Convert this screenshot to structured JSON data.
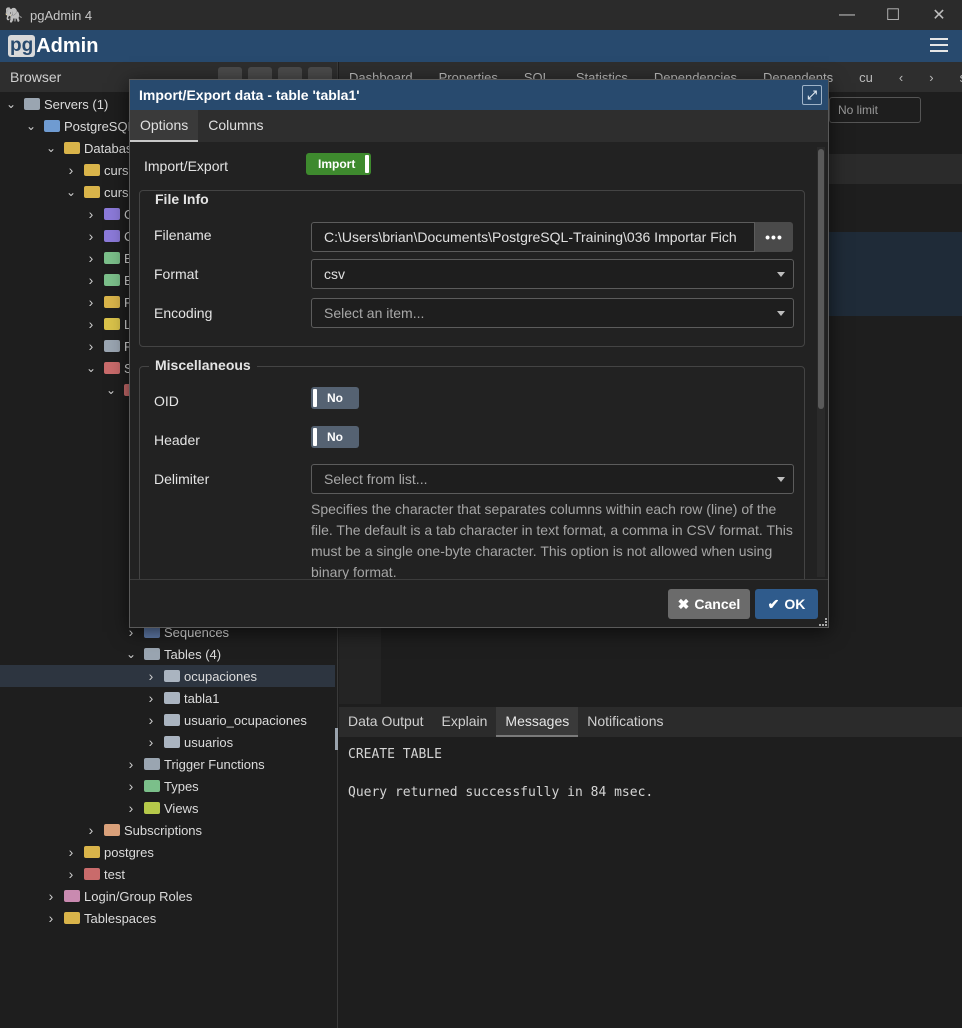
{
  "window": {
    "title": "pgAdmin 4",
    "minimize_icon": "minimize-icon",
    "maximize_icon": "maximize-icon",
    "close_icon": "close-icon"
  },
  "app": {
    "logo_pg": "pg",
    "logo_admin": "Admin",
    "brand_color": "#284a6e"
  },
  "browser": {
    "title": "Browser",
    "tree": [
      {
        "label": "Servers (1)",
        "level": 0,
        "open": true,
        "icon": "servers-icon"
      },
      {
        "label": "PostgreSQL",
        "level": 1,
        "open": true,
        "icon": "elephant-icon"
      },
      {
        "label": "Databas",
        "level": 2,
        "open": true,
        "icon": "databases-icon"
      },
      {
        "label": "curso",
        "level": 3,
        "open": false,
        "icon": "database-icon"
      },
      {
        "label": "curso",
        "level": 3,
        "open": true,
        "icon": "database-icon"
      },
      {
        "label": "C",
        "level": 4,
        "open": false,
        "icon": "casts-icon"
      },
      {
        "label": "C",
        "level": 4,
        "open": false,
        "icon": "catalogs-icon"
      },
      {
        "label": "E",
        "level": 4,
        "open": false,
        "icon": "event-triggers-icon"
      },
      {
        "label": "E",
        "level": 4,
        "open": false,
        "icon": "extensions-icon"
      },
      {
        "label": "F",
        "level": 4,
        "open": false,
        "icon": "foreign-data-icon"
      },
      {
        "label": "L",
        "level": 4,
        "open": false,
        "icon": "languages-icon"
      },
      {
        "label": "P",
        "level": 4,
        "open": false,
        "icon": "publications-icon"
      },
      {
        "label": "S",
        "level": 4,
        "open": true,
        "icon": "schemas-icon"
      },
      {
        "label": "",
        "level": 5,
        "open": true,
        "icon": "schema-icon"
      },
      {
        "label": "Sequences",
        "level": 6,
        "open": false,
        "icon": "sequences-icon"
      },
      {
        "label": "Tables (4)",
        "level": 6,
        "open": true,
        "icon": "tables-icon"
      },
      {
        "label": "ocupaciones",
        "level": 7,
        "open": false,
        "icon": "table-icon",
        "selected": true
      },
      {
        "label": "tabla1",
        "level": 7,
        "open": false,
        "icon": "table-icon"
      },
      {
        "label": "usuario_ocupaciones",
        "level": 7,
        "open": false,
        "icon": "table-icon"
      },
      {
        "label": "usuarios",
        "level": 7,
        "open": false,
        "icon": "table-icon"
      },
      {
        "label": "Trigger Functions",
        "level": 6,
        "open": false,
        "icon": "trigger-functions-icon"
      },
      {
        "label": "Types",
        "level": 6,
        "open": false,
        "icon": "types-icon"
      },
      {
        "label": "Views",
        "level": 6,
        "open": false,
        "icon": "views-icon"
      },
      {
        "label": "Subscriptions",
        "level": 4,
        "open": false,
        "icon": "subscriptions-icon"
      },
      {
        "label": "postgres",
        "level": 3,
        "open": false,
        "icon": "database-icon"
      },
      {
        "label": "test",
        "level": 3,
        "open": false,
        "icon": "database-red-icon"
      },
      {
        "label": "Login/Group Roles",
        "level": 2,
        "open": false,
        "icon": "roles-icon"
      },
      {
        "label": "Tablespaces",
        "level": 2,
        "open": false,
        "icon": "tablespaces-icon"
      }
    ]
  },
  "main": {
    "tabs": [
      "Dashboard",
      "Properties",
      "SQL",
      "Statistics",
      "Dependencies",
      "Dependents"
    ],
    "tab_cut": "cu",
    "tab_cut2": "sgre",
    "limit_select": "No limit"
  },
  "results": {
    "tabs": [
      "Data Output",
      "Explain",
      "Messages",
      "Notifications"
    ],
    "active_tab": "Messages",
    "lines": [
      "CREATE TABLE",
      "",
      "Query returned successfully in 84 msec."
    ]
  },
  "dialog": {
    "title": "Import/Export data - table 'tabla1'",
    "tabs": [
      "Options",
      "Columns"
    ],
    "active_tab": "Options",
    "import_export_label": "Import/Export",
    "import_export_value": "Import",
    "file_info_legend": "File Info",
    "filename_label": "Filename",
    "filename_value": "C:\\Users\\brian\\Documents\\PostgreSQL-Training\\036 Importar Fich",
    "browse_button": "•••",
    "format_label": "Format",
    "format_value": "csv",
    "encoding_label": "Encoding",
    "encoding_placeholder": "Select an item...",
    "misc_legend": "Miscellaneous",
    "oid_label": "OID",
    "oid_value": "No",
    "header_label": "Header",
    "header_value": "No",
    "delimiter_label": "Delimiter",
    "delimiter_placeholder": "Select from list...",
    "delimiter_help": "Specifies the character that separates columns within each row (line) of the file. The default is a tab character in text format, a comma in CSV format. This must be a single one-byte character. This option is not allowed when using binary format.",
    "cancel_label": "Cancel",
    "ok_label": "OK",
    "toggle_on_color": "#3e8a2e",
    "toggle_off_color": "#556272",
    "ok_color": "#2f5b8c",
    "cancel_color": "#6b6b6b"
  }
}
